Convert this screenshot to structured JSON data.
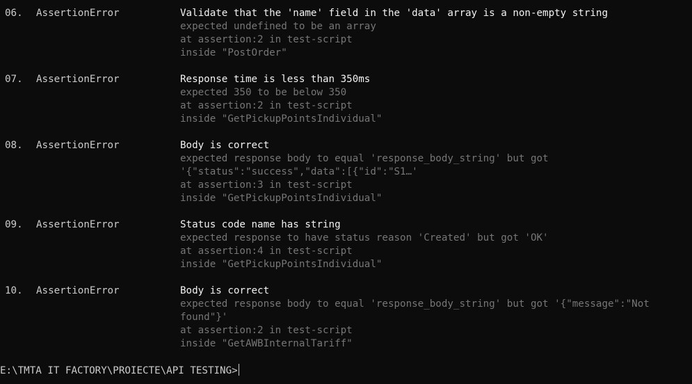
{
  "entries": [
    {
      "number": "06.",
      "error_type": "AssertionError",
      "title": "Validate that the 'name' field in the 'data' array is a non-empty string",
      "details": [
        "expected undefined to be an array",
        "at assertion:2 in test-script",
        "inside \"PostOrder\""
      ]
    },
    {
      "number": "07.",
      "error_type": "AssertionError",
      "title": "Response time is less than 350ms",
      "details": [
        "expected 350 to be below 350",
        "at assertion:2 in test-script",
        "inside \"GetPickupPointsIndividual\""
      ]
    },
    {
      "number": "08.",
      "error_type": "AssertionError",
      "title": "Body is correct",
      "details": [
        "expected response body to equal 'response_body_string' but got",
        "'{\"status\":\"success\",\"data\":[{\"id\":\"S1…'",
        "at assertion:3 in test-script",
        "inside \"GetPickupPointsIndividual\""
      ]
    },
    {
      "number": "09.",
      "error_type": "AssertionError",
      "title": "Status code name has string",
      "details": [
        "expected response to have status reason 'Created' but got 'OK'",
        "at assertion:4 in test-script",
        "inside \"GetPickupPointsIndividual\""
      ]
    },
    {
      "number": "10.",
      "error_type": "AssertionError",
      "title": "Body is correct",
      "details": [
        "expected response body to equal 'response_body_string' but got '{\"message\":\"Not",
        "found\"}'",
        "at assertion:2 in test-script",
        "inside \"GetAWBInternalTariff\""
      ]
    }
  ],
  "prompt": "E:\\TMTA IT FACTORY\\PROIECTE\\API TESTING>",
  "colors": {
    "background": "#0c0c0c",
    "text": "#cccccc",
    "title": "#f2f2f2",
    "detail": "#767676"
  }
}
